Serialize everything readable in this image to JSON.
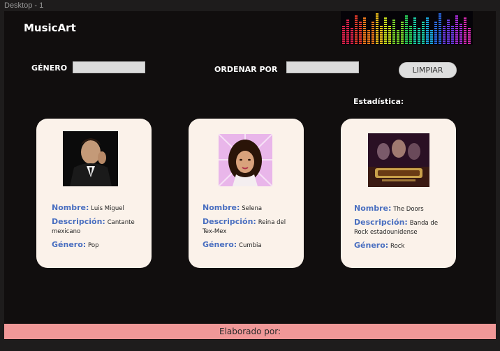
{
  "window": {
    "frame_label": "Desktop - 1"
  },
  "header": {
    "logo": "MusicArt",
    "equalizer_icon": "equalizer-icon"
  },
  "filters": {
    "genre_label": "GÉNERO",
    "genre_value": "",
    "order_label": "ORDENAR POR",
    "order_value": "",
    "clear_label": "LIMPIAR"
  },
  "stats": {
    "label": "Estadística:"
  },
  "field_labels": {
    "name": "Nombre:",
    "description": "Descripción:",
    "genre": "Género:"
  },
  "artists": [
    {
      "name": "Luis Miguel",
      "description": "Cantante mexicano",
      "genre": "Pop",
      "photo_icon": "artist-photo-icon"
    },
    {
      "name": "Selena",
      "description": "Reina del Tex-Mex",
      "genre": "Cumbia",
      "photo_icon": "artist-photo-icon"
    },
    {
      "name": "The Doors",
      "description": "Banda de Rock estadounidense",
      "genre": "Rock",
      "photo_icon": "album-cover-icon"
    }
  ],
  "footer": {
    "text": "Elaborado por:"
  },
  "colors": {
    "background": "#110e0e",
    "card": "#fbf2ea",
    "field_label": "#4a6fc0",
    "footer": "#f09898"
  }
}
